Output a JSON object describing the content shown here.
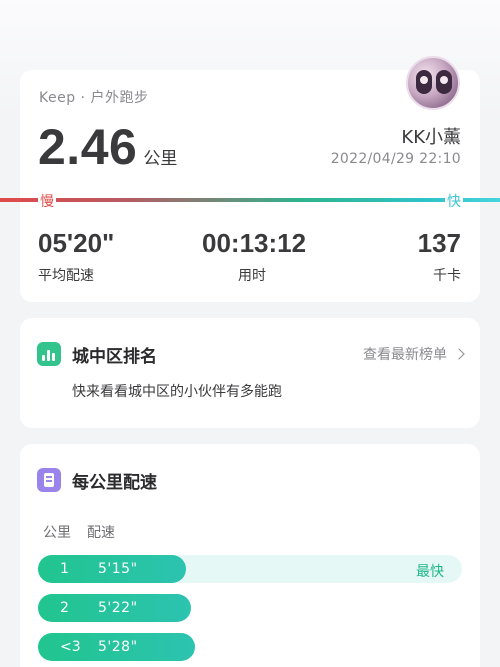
{
  "summary": {
    "app_label": "Keep · 户外跑步",
    "distance_value": "2.46",
    "distance_unit": "公里",
    "username": "KK小薰",
    "datetime": "2022/04/29 22:10",
    "slow_label": "慢",
    "fast_label": "快",
    "stats": [
      {
        "value": "05'20\"",
        "label": "平均配速"
      },
      {
        "value": "00:13:12",
        "label": "用时"
      },
      {
        "value": "137",
        "label": "千卡"
      }
    ]
  },
  "ranking": {
    "icon": "bar-chart-icon",
    "title": "城中区排名",
    "link_label": "查看最新榜单",
    "description": "快来看看城中区的小伙伴有多能跑"
  },
  "per_km": {
    "icon": "flag-icon",
    "title": "每公里配速",
    "col_km": "公里",
    "col_pace": "配速",
    "rows": [
      {
        "km": "1",
        "pace": "5'15\"",
        "fill_fraction": 0.35,
        "badge": "最快"
      },
      {
        "km": "2",
        "pace": "5'22\"",
        "fill_fraction": 0.36,
        "badge": ""
      },
      {
        "km": "<3",
        "pace": "5'28\"",
        "fill_fraction": 0.37,
        "badge": ""
      }
    ]
  },
  "colors": {
    "accent_green": "#21c58e",
    "slow_red": "#e04a4a",
    "fast_cyan": "#3cc6cf",
    "purple": "#9a83ea"
  }
}
